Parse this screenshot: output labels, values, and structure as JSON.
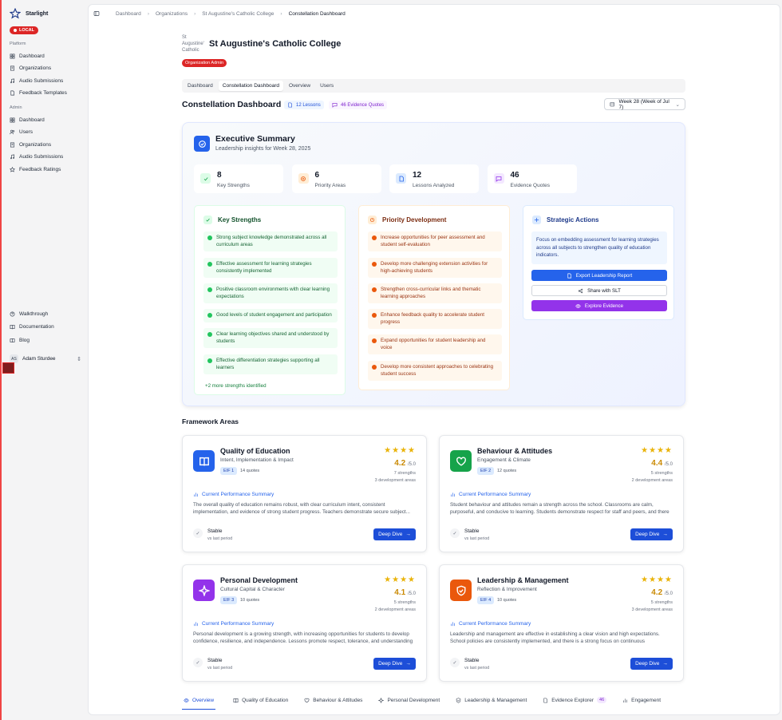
{
  "brand": {
    "name": "Starlight",
    "badge": "LOCAL"
  },
  "sidebar": {
    "platform_label": "Platform",
    "platform_items": [
      {
        "label": "Dashboard",
        "icon": "grid-icon"
      },
      {
        "label": "Organizations",
        "icon": "building-icon"
      },
      {
        "label": "Audio Submissions",
        "icon": "music-icon"
      },
      {
        "label": "Feedback Templates",
        "icon": "file-icon"
      }
    ],
    "admin_label": "Admin",
    "admin_items": [
      {
        "label": "Dashboard",
        "icon": "grid-icon"
      },
      {
        "label": "Users",
        "icon": "users-icon"
      },
      {
        "label": "Organizations",
        "icon": "building-icon"
      },
      {
        "label": "Audio Submissions",
        "icon": "music-icon"
      },
      {
        "label": "Feedback Ratings",
        "icon": "star-icon"
      }
    ],
    "bottom_items": [
      {
        "label": "Walkthrough",
        "icon": "help-icon"
      },
      {
        "label": "Documentation",
        "icon": "book-icon"
      },
      {
        "label": "Blog",
        "icon": "book-open-icon"
      }
    ],
    "user": {
      "initials": "AS",
      "name": "Adam Sturdee"
    }
  },
  "breadcrumb": [
    "Dashboard",
    "Organizations",
    "St Augustine's Catholic College",
    "Constellation Dashboard"
  ],
  "org": {
    "logo_alt": "St Augustine's Catholic",
    "name": "St Augustine's Catholic College",
    "role_badge": "Organization Admin"
  },
  "tabs": [
    "Dashboard",
    "Constellation Dashboard",
    "Overview",
    "Users"
  ],
  "page": {
    "title": "Constellation Dashboard",
    "lessons_chip": "12 Lessons",
    "quotes_chip": "46 Evidence Quotes",
    "week": "Week 28 (Week of Jul 7)"
  },
  "exec": {
    "title": "Executive Summary",
    "subtitle": "Leadership insights for Week 28, 2025",
    "stats": [
      {
        "value": "8",
        "label": "Key Strengths",
        "color": "#16a34a",
        "bg": "#dcfce7"
      },
      {
        "value": "6",
        "label": "Priority Areas",
        "color": "#ea580c",
        "bg": "#ffedd5"
      },
      {
        "value": "12",
        "label": "Lessons Analyzed",
        "color": "#2563eb",
        "bg": "#dbeafe"
      },
      {
        "value": "46",
        "label": "Evidence Quotes",
        "color": "#9333ea",
        "bg": "#f3e8ff"
      }
    ]
  },
  "strengths": {
    "title": "Key Strengths",
    "items": [
      "Strong subject knowledge demonstrated across all curriculum areas",
      "Effective assessment for learning strategies consistently implemented",
      "Positive classroom environments with clear learning expectations",
      "Good levels of student engagement and participation",
      "Clear learning objectives shared and understood by students",
      "Effective differentiation strategies supporting all learners"
    ],
    "more": "+2 more strengths identified"
  },
  "priorities": {
    "title": "Priority Development",
    "items": [
      "Increase opportunities for peer assessment and student self-evaluation",
      "Develop more challenging extension activities for high-achieving students",
      "Strengthen cross-curricular links and thematic learning approaches",
      "Enhance feedback quality to accelerate student progress",
      "Expand opportunities for student leadership and voice",
      "Develop more consistent approaches to celebrating student success"
    ]
  },
  "actions": {
    "title": "Strategic Actions",
    "text": "Focus on embedding assessment for learning strategies across all subjects to strengthen quality of education indicators.",
    "export": "Export Leadership Report",
    "share": "Share with SLT",
    "explore": "Explore Evidence"
  },
  "framework": {
    "title": "Framework Areas",
    "summary_label": "Current Performance Summary",
    "deep_dive": "Deep Dive",
    "cards": [
      {
        "title": "Quality of Education",
        "subtitle": "Intent, Implementation & Impact",
        "eif": "EIF 1",
        "quotes": "14 quotes",
        "stars": "★★★★",
        "score": "4.2",
        "out_of": "/5.0",
        "strengths": "7 strengths",
        "dev": "3 development areas",
        "desc": "The overall quality of education remains robust, with clear curriculum intent, consistent implementation, and evidence of strong student progress. Teachers demonstrate secure subject...",
        "trend": "Stable",
        "trend_sub": "vs last period",
        "color": "#2563eb",
        "icon": "book-icon"
      },
      {
        "title": "Behaviour & Attitudes",
        "subtitle": "Engagement & Climate",
        "eif": "EIF 2",
        "quotes": "12 quotes",
        "stars": "★★★★",
        "score": "4.4",
        "out_of": "/5.0",
        "strengths": "5 strengths",
        "dev": "2 development areas",
        "desc": "Student behaviour and attitudes remain a strength across the school. Classrooms are calm, purposeful, and conducive to learning. Students demonstrate respect for staff and peers, and there ar...",
        "trend": "Stable",
        "trend_sub": "vs last period",
        "color": "#16a34a",
        "icon": "heart-icon"
      },
      {
        "title": "Personal Development",
        "subtitle": "Cultural Capital & Character",
        "eif": "EIF 3",
        "quotes": "10 quotes",
        "stars": "★★★★",
        "score": "4.1",
        "out_of": "/5.0",
        "strengths": "5 strengths",
        "dev": "2 development areas",
        "desc": "Personal development is a growing strength, with increasing opportunities for students to develop confidence, resilience, and independence. Lessons promote respect, tolerance, and understanding of...",
        "trend": "Stable",
        "trend_sub": "vs last period",
        "color": "#9333ea",
        "icon": "sparkle-icon"
      },
      {
        "title": "Leadership & Management",
        "subtitle": "Reflection & Improvement",
        "eif": "EIF 4",
        "quotes": "10 quotes",
        "stars": "★★★★",
        "score": "4.2",
        "out_of": "/5.0",
        "strengths": "5 strengths",
        "dev": "3 development areas",
        "desc": "Leadership and management are effective in establishing a clear vision and high expectations. School policies are consistently implemented, and there is a strong focus on continuous improvement...",
        "trend": "Stable",
        "trend_sub": "vs last period",
        "color": "#ea580c",
        "icon": "shield-icon"
      }
    ]
  },
  "bottom_tabs": [
    {
      "label": "Overview",
      "icon": "eye-icon"
    },
    {
      "label": "Quality of Education",
      "icon": "book-icon"
    },
    {
      "label": "Behaviour & Attitudes",
      "icon": "heart-icon"
    },
    {
      "label": "Personal Development",
      "icon": "sparkle-icon"
    },
    {
      "label": "Leadership & Management",
      "icon": "shield-icon"
    },
    {
      "label": "Evidence Explorer",
      "icon": "file-icon",
      "count": "46"
    },
    {
      "label": "Engagement",
      "icon": "chart-icon"
    }
  ]
}
